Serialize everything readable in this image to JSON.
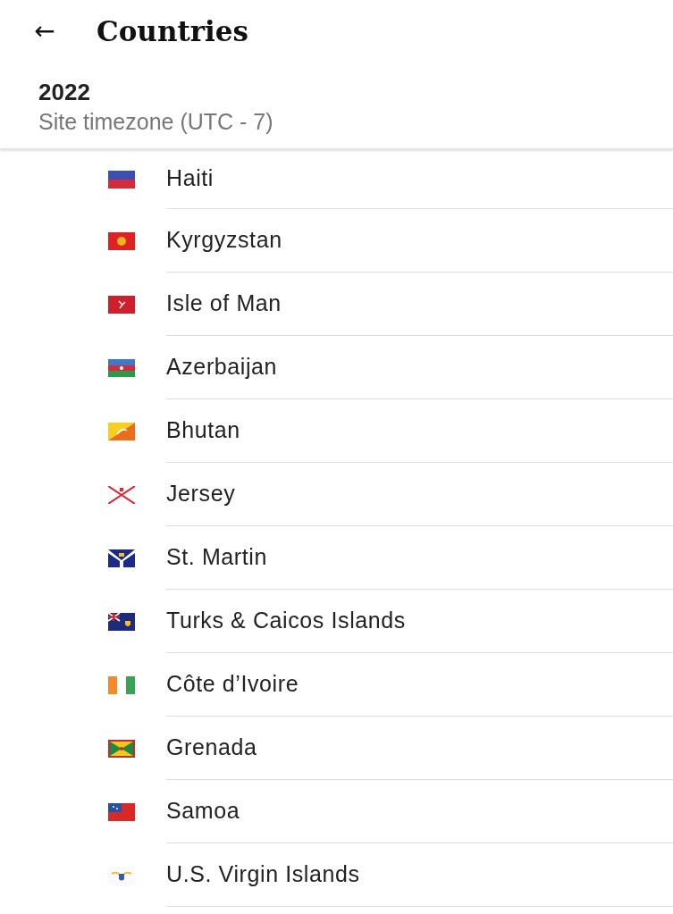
{
  "app_bar": {
    "back": "←",
    "title": "Countries"
  },
  "header": {
    "year": "2022",
    "subtitle": "Site timezone (UTC - 7)"
  },
  "countries": [
    {
      "name": "Haiti"
    },
    {
      "name": "Kyrgyzstan"
    },
    {
      "name": "Isle of Man"
    },
    {
      "name": "Azerbaijan"
    },
    {
      "name": "Bhutan"
    },
    {
      "name": "Jersey"
    },
    {
      "name": "St. Martin"
    },
    {
      "name": "Turks & Caicos Islands"
    },
    {
      "name": "Côte d’Ivoire"
    },
    {
      "name": "Grenada"
    },
    {
      "name": "Samoa"
    },
    {
      "name": "U.S. Virgin Islands"
    }
  ]
}
